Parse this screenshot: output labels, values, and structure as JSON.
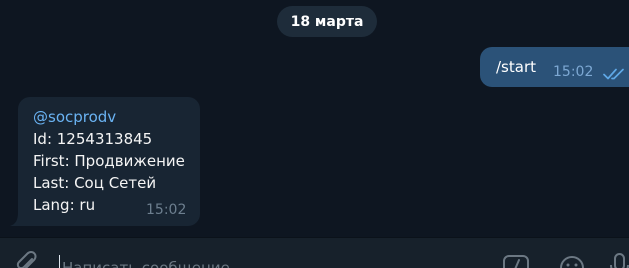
{
  "date_separator": "18 марта",
  "outgoing_message": {
    "text": "/start",
    "time": "15:02",
    "status_icon": "double-check-icon"
  },
  "incoming_message": {
    "username": "@socprodv",
    "lines": [
      "Id: 1254313845",
      "First: Продвижение",
      "Last: Соц Сетей",
      "Lang: ru"
    ],
    "time": "15:02"
  },
  "composer": {
    "placeholder": "Написать сообщение",
    "value": ""
  },
  "icons": {
    "attach": "paperclip-icon",
    "commands": "bot-commands-icon",
    "emoji": "emoji-icon",
    "voice": "microphone-icon"
  },
  "colors": {
    "chat_background": "#0e1621",
    "outgoing_bubble": "#2b5278",
    "incoming_bubble": "#182533",
    "link": "#6ab3f3",
    "composer_background": "#17212b"
  }
}
